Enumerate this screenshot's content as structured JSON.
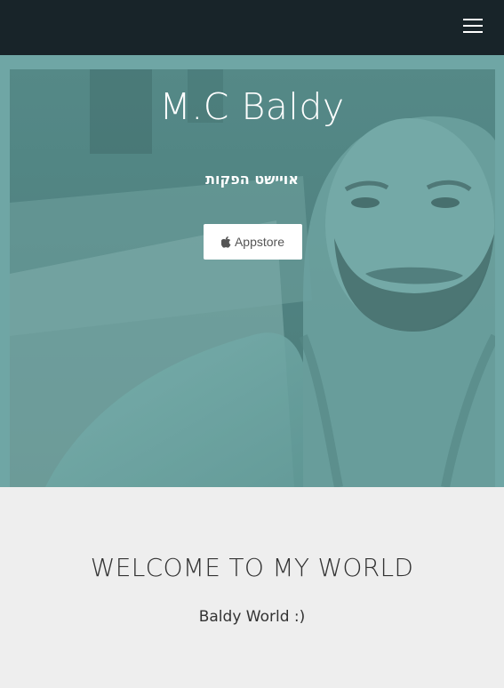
{
  "navbar": {
    "menu_icon": "hamburger-menu-icon",
    "background_color": "#182429"
  },
  "hero": {
    "title": "M.C Baldy",
    "subtitle": "אויישט הפקות",
    "appstore_button": {
      "label": "Appstore",
      "icon": "apple-icon"
    },
    "overlay_color": "#6fa6a5"
  },
  "welcome": {
    "title": "WELCOME TO MY WORLD",
    "text": "Baldy World :)"
  }
}
